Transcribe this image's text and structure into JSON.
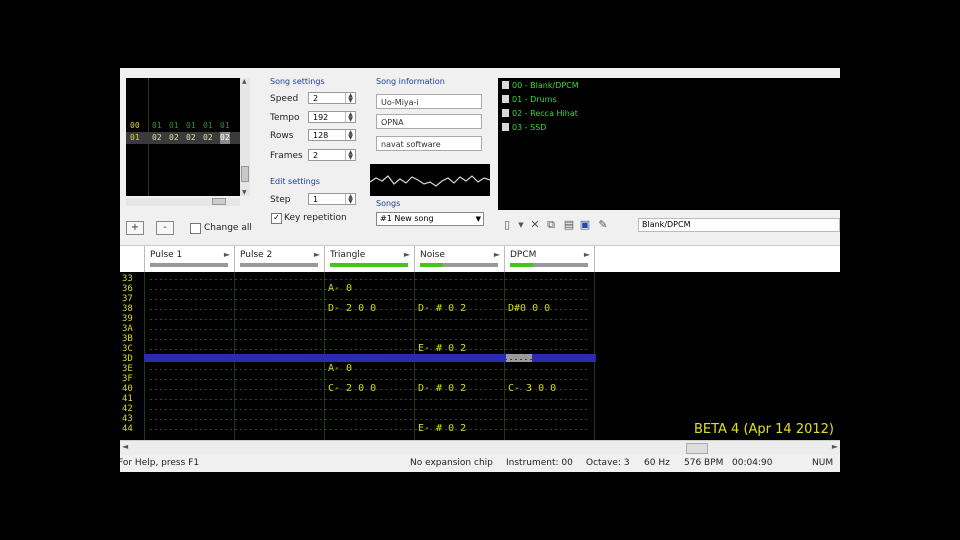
{
  "frames": {
    "rows": [
      {
        "num": "00",
        "cells": [
          "01",
          "01",
          "01",
          "01",
          "01"
        ],
        "highlight": false
      },
      {
        "num": "01",
        "cells": [
          "02",
          "02",
          "02",
          "02",
          "02"
        ],
        "highlight": true
      }
    ],
    "add_label": "+",
    "remove_label": "-",
    "change_all_label": "Change all"
  },
  "song_settings": {
    "title": "Song settings",
    "speed_label": "Speed",
    "speed_value": "2",
    "tempo_label": "Tempo",
    "tempo_value": "192",
    "rows_label": "Rows",
    "rows_value": "128",
    "frames_label": "Frames",
    "frames_value": "2"
  },
  "edit_settings": {
    "title": "Edit settings",
    "step_label": "Step",
    "step_value": "1",
    "key_repetition_label": "Key repetition",
    "key_repetition_checked": true
  },
  "song_info": {
    "title": "Song information",
    "name": "Uo-Miya-i",
    "artist": "OPNA",
    "copyright": "navat software"
  },
  "songs": {
    "title": "Songs",
    "selected": "#1 New song"
  },
  "instruments": [
    {
      "label": "00 - Blank/DPCM"
    },
    {
      "label": "01 - Drums"
    },
    {
      "label": "02 - Recca Hihat"
    },
    {
      "label": "03 - SSD"
    }
  ],
  "instrument_name": "Blank/DPCM",
  "channels": [
    {
      "name": "Pulse 1",
      "level": 0
    },
    {
      "name": "Pulse 2",
      "level": 0
    },
    {
      "name": "Triangle",
      "level": 1.0
    },
    {
      "name": "Noise",
      "level": 0.3
    },
    {
      "name": "DPCM",
      "level": 0.3
    }
  ],
  "pattern": {
    "row_numbers": [
      "33",
      "36",
      "37",
      "38",
      "39",
      "3A",
      "3B",
      "3C",
      "3D",
      "3E",
      "3F",
      "40",
      "41",
      "42",
      "43",
      "44"
    ],
    "notes": [
      {
        "row": 1,
        "channel": 2,
        "text": "A- 0"
      },
      {
        "row": 3,
        "channel": 2,
        "text": "D- 2 0 0"
      },
      {
        "row": 3,
        "channel": 3,
        "text": "D- # 0 2"
      },
      {
        "row": 3,
        "channel": 4,
        "text": "D#0 0 0"
      },
      {
        "row": 7,
        "channel": 3,
        "text": "E- # 0 2"
      },
      {
        "row": 9,
        "channel": 2,
        "text": "A- 0"
      },
      {
        "row": 11,
        "channel": 2,
        "text": "C- 2 0 0"
      },
      {
        "row": 11,
        "channel": 3,
        "text": "D- # 0 2"
      },
      {
        "row": 11,
        "channel": 4,
        "text": "C- 3 0 0"
      },
      {
        "row": 15,
        "channel": 3,
        "text": "E- # 0 2"
      }
    ]
  },
  "version_label": "BETA 4 (Apr 14 2012)",
  "status": {
    "help": "For Help, press F1",
    "expansion": "No expansion chip",
    "instrument": "Instrument: 00",
    "octave": "Octave: 3",
    "rate": "60 Hz",
    "bpm": "576 BPM",
    "time": "00:04:90",
    "num": "NUM"
  },
  "colors": {
    "pattern_text": "#d8d820",
    "row_number": "#d8d820",
    "instrument_text": "#39d839",
    "cursor_row": "#2b2bb0",
    "vu_fill": "#46c41c"
  }
}
